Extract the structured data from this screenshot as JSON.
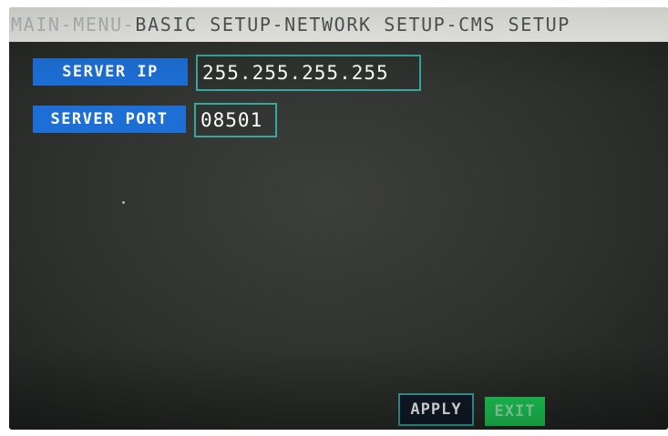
{
  "header": {
    "breadcrumb_faded": "MAIN-MENU-",
    "breadcrumb_main": "BASIC SETUP-NETWORK SETUP-CMS SETUP"
  },
  "form": {
    "server_ip_label": "SERVER IP",
    "server_ip_value": "255.255.255.255",
    "server_port_label": "SERVER PORT",
    "server_port_value": "08501"
  },
  "buttons": {
    "apply_label": "APPLY",
    "exit_label": "EXIT"
  },
  "colors": {
    "label_bg": "#1d6fd6",
    "field_border": "#3aa6a0",
    "exit_bg": "#1fd35a"
  }
}
